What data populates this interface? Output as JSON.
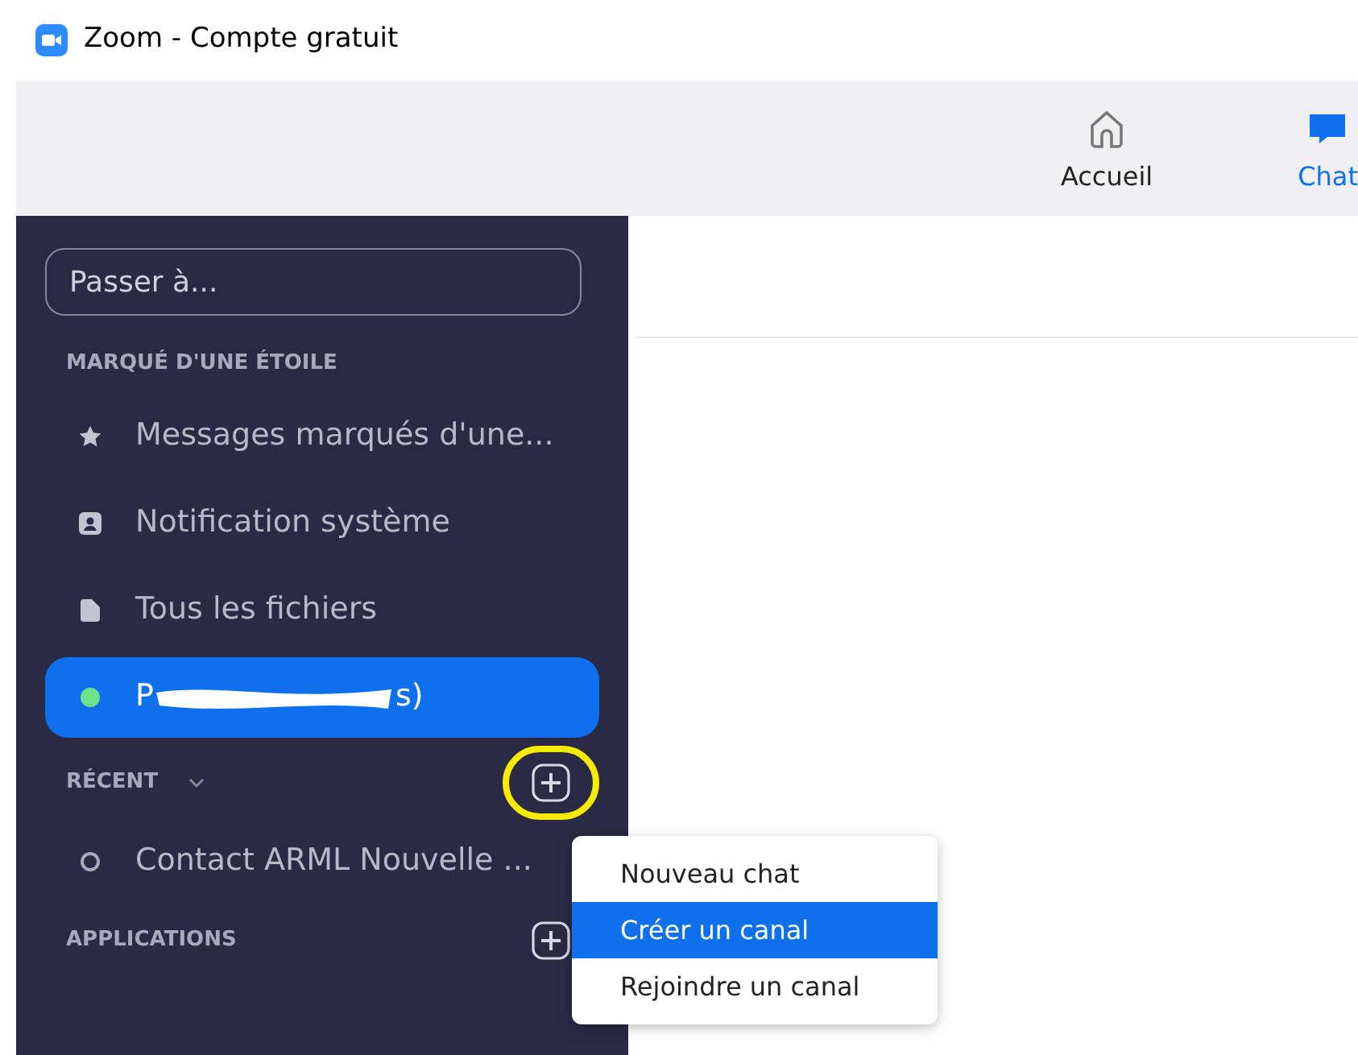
{
  "window": {
    "title": "Zoom - Compte gratuit"
  },
  "nav_tabs": [
    {
      "label": "Accueil",
      "kind": "home",
      "selected": false
    },
    {
      "label": "Chat",
      "kind": "chat",
      "selected": true
    }
  ],
  "sidebar": {
    "search": {
      "placeholder": "Passer à..."
    },
    "starred": {
      "heading": "MARQUÉ D'UNE ÉTOILE",
      "items": [
        {
          "label": "Messages marqués d'une...",
          "kind": "star",
          "selected": false
        },
        {
          "label": "Notification système",
          "kind": "contact",
          "selected": false
        },
        {
          "label": "Tous les fichiers",
          "kind": "file",
          "selected": false
        },
        {
          "label_start": "P",
          "label_end": "s)",
          "kind": "online",
          "selected": true
        }
      ]
    },
    "recent": {
      "heading": "RÉCENT",
      "items": [
        {
          "label": "Contact  ARML Nouvelle ...",
          "kind": "offline",
          "selected": false
        }
      ]
    },
    "applications": {
      "heading": "APPLICATIONS"
    }
  },
  "menu": {
    "items": [
      {
        "label": "Nouveau chat",
        "selected": false
      },
      {
        "label": "Créer un canal",
        "selected": true
      },
      {
        "label": "Rejoindre un canal",
        "selected": false
      }
    ]
  }
}
